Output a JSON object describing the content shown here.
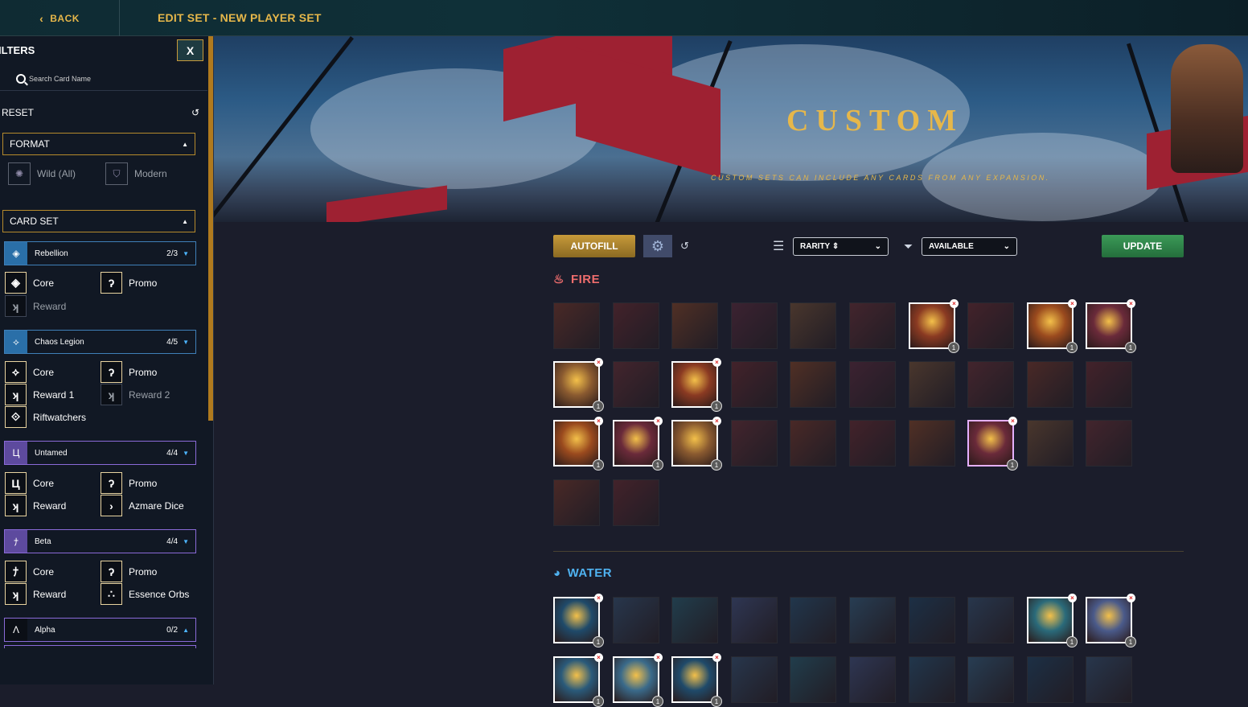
{
  "topbar": {
    "back_label": "BACK",
    "title": "EDIT SET - NEW PLAYER SET"
  },
  "sidebar": {
    "title": "ILTERS",
    "close_label": "X",
    "search_placeholder": "Search Card Name",
    "reset_label": "RESET",
    "format": {
      "label": "FORMAT",
      "options": [
        {
          "label": "Wild (All)",
          "icon": "wild-icon"
        },
        {
          "label": "Modern",
          "icon": "modern-shield-icon"
        }
      ]
    },
    "card_set": {
      "label": "CARD SET",
      "sets": [
        {
          "name": "Rebellion",
          "count": "2/3",
          "options": [
            "Core",
            "Promo",
            "Reward"
          ]
        },
        {
          "name": "Chaos Legion",
          "count": "4/5",
          "options": [
            "Core",
            "Promo",
            "Reward 1",
            "Reward 2",
            "Riftwatchers"
          ]
        },
        {
          "name": "Untamed",
          "count": "4/4",
          "options": [
            "Core",
            "Promo",
            "Reward",
            "Azmare Dice"
          ]
        },
        {
          "name": "Beta",
          "count": "4/4",
          "options": [
            "Core",
            "Promo",
            "Reward",
            "Essence Orbs"
          ]
        },
        {
          "name": "Alpha",
          "count": "0/2",
          "options": []
        }
      ]
    }
  },
  "banner": {
    "title": "CUSTOM",
    "subtitle": "CUSTOM SETS CAN INCLUDE ANY CARDS FROM ANY EXPANSION."
  },
  "controls": {
    "autofill_label": "AUTOFILL",
    "rarity_label": "RARITY ⇕",
    "availability_label": "AVAILABLE",
    "update_label": "UPDATE"
  },
  "elements": {
    "fire_label": "FIRE",
    "water_label": "WATER"
  },
  "colors": {
    "gold": "#e6b74a",
    "fire": "#ef6d6d",
    "water": "#4fb2f0",
    "update_green": "#2f8a4a"
  },
  "badges": {
    "remove": "×",
    "qty": "1"
  }
}
